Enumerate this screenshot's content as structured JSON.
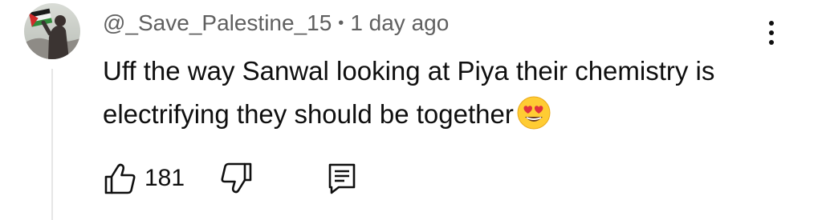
{
  "comment": {
    "author": "@_Save_Palestine_15",
    "separator": "•",
    "time": "1 day ago",
    "text": "Uff the way Sanwal looking at Piya their chemistry is electrifying they should be together",
    "emoji": "smiling-face-with-heart-eyes"
  },
  "actions": {
    "like_icon": "thumbs-up-icon",
    "like_count": "181",
    "dislike_icon": "thumbs-down-icon",
    "reply_icon": "comment-icon"
  },
  "menu": {
    "icon": "more-vert-icon"
  }
}
